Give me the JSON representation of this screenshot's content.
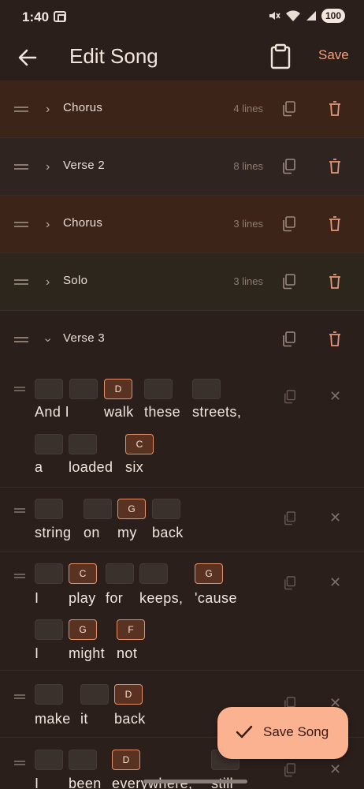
{
  "status": {
    "time": "1:40",
    "battery": "100"
  },
  "appbar": {
    "title": "Edit Song",
    "save_label": "Save"
  },
  "sections": [
    {
      "name": "Chorus",
      "count": "4 lines"
    },
    {
      "name": "Verse 2",
      "count": "8 lines"
    },
    {
      "name": "Chorus",
      "count": "3 lines"
    },
    {
      "name": "Solo",
      "count": "3 lines"
    },
    {
      "name": "Verse 3",
      "count": ""
    }
  ],
  "chords": [
    "D",
    "C",
    "G",
    "C",
    "G",
    "G",
    "F",
    "D",
    "D"
  ],
  "lyrics": {
    "l1a": [
      "And I",
      "walk",
      "these",
      "streets,"
    ],
    "l1b": [
      "a",
      "loaded",
      "six"
    ],
    "l2": [
      "string",
      "on",
      "my",
      "back"
    ],
    "l3a": [
      "I",
      "play",
      "for",
      "keeps,",
      "'cause"
    ],
    "l3b": [
      "I",
      "might",
      "not"
    ],
    "l4": [
      "make",
      "it",
      "back"
    ],
    "l5": [
      "I",
      "been",
      "everywhere,",
      "still"
    ]
  },
  "fab": {
    "label": "Save Song"
  }
}
